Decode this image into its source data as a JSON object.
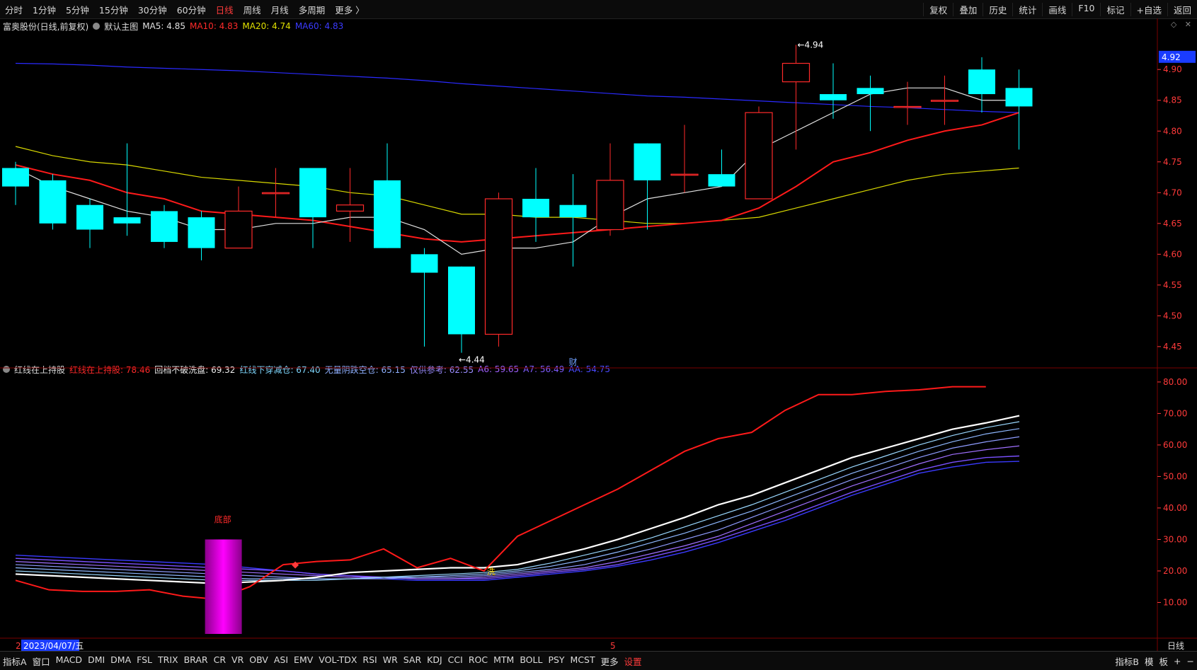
{
  "toolbar": {
    "periods": [
      "分时",
      "1分钟",
      "5分钟",
      "15分钟",
      "30分钟",
      "60分钟",
      "日线",
      "周线",
      "月线",
      "多周期",
      "更多 〉"
    ],
    "active_period": "日线",
    "right_items": [
      "复权",
      "叠加",
      "历史",
      "统计",
      "画线",
      "F10",
      "标记",
      "+自选",
      "返回"
    ]
  },
  "main_legend": {
    "stock": "富奥股份(日线,前复权)",
    "template": "默认主图",
    "ma5_label": "MA5: 4.85",
    "ma10_label": "MA10: 4.83",
    "ma20_label": "MA20: 4.74",
    "ma60_label": "MA60: 4.83"
  },
  "indicator_legend": {
    "name": "红线在上持股",
    "l1": "红线在上持股: 78.46",
    "l2": "回档不破洗盘: 69.32",
    "l3": "红线下穿减仓: 67.40",
    "l4": "无量阴跌空仓: 65.15",
    "l5": "仅供参考: 62.55",
    "l6": "A6: 59.65",
    "l7": "A7: 56.49",
    "l8": "AA: 54.75"
  },
  "bottom": {
    "tabs": [
      "指标A",
      "窗口",
      "MACD",
      "DMI",
      "DMA",
      "FSL",
      "TRIX",
      "BRAR",
      "CR",
      "VR",
      "OBV",
      "ASI",
      "EMV",
      "VOL-TDX",
      "RSI",
      "WR",
      "SAR",
      "KDJ",
      "CCI",
      "ROC",
      "MTM",
      "BOLL",
      "PSY",
      "MCST",
      "更多",
      "设置"
    ],
    "active_tab": "设置",
    "right": [
      "指标B",
      "模",
      "板",
      "+",
      "−"
    ]
  },
  "colors": {
    "up": "#ff2a2a",
    "down": "#00ffff",
    "ma5": "#e0e0e0",
    "ma10": "#ff1a1a",
    "ma20": "#d8d800",
    "ma60": "#2a2aff",
    "grid": "#7a0000",
    "axis": "#ff3a3a"
  },
  "chart_data": [
    {
      "type": "candlestick",
      "ylim": [
        4.42,
        4.96
      ],
      "yticks": [
        4.45,
        4.5,
        4.55,
        4.6,
        4.65,
        4.7,
        4.75,
        4.8,
        4.85,
        4.9
      ],
      "last_price_label": "4.92",
      "high_label": "4.94",
      "low_label": "4.44",
      "event_label": "财",
      "candles": [
        {
          "o": 4.74,
          "h": 4.75,
          "l": 4.68,
          "c": 4.71
        },
        {
          "o": 4.72,
          "h": 4.73,
          "l": 4.64,
          "c": 4.65
        },
        {
          "o": 4.68,
          "h": 4.69,
          "l": 4.61,
          "c": 4.64
        },
        {
          "o": 4.66,
          "h": 4.78,
          "l": 4.63,
          "c": 4.65
        },
        {
          "o": 4.67,
          "h": 4.68,
          "l": 4.61,
          "c": 4.62
        },
        {
          "o": 4.66,
          "h": 4.67,
          "l": 4.59,
          "c": 4.61
        },
        {
          "o": 4.61,
          "h": 4.71,
          "l": 4.61,
          "c": 4.67
        },
        {
          "o": 4.7,
          "h": 4.74,
          "l": 4.66,
          "c": 4.7
        },
        {
          "o": 4.74,
          "h": 4.74,
          "l": 4.61,
          "c": 4.66
        },
        {
          "o": 4.67,
          "h": 4.74,
          "l": 4.62,
          "c": 4.68
        },
        {
          "o": 4.72,
          "h": 4.78,
          "l": 4.61,
          "c": 4.61
        },
        {
          "o": 4.6,
          "h": 4.61,
          "l": 4.45,
          "c": 4.57
        },
        {
          "o": 4.58,
          "h": 4.58,
          "l": 4.44,
          "c": 4.47
        },
        {
          "o": 4.47,
          "h": 4.7,
          "l": 4.45,
          "c": 4.69
        },
        {
          "o": 4.69,
          "h": 4.74,
          "l": 4.62,
          "c": 4.66
        },
        {
          "o": 4.68,
          "h": 4.73,
          "l": 4.58,
          "c": 4.66
        },
        {
          "o": 4.64,
          "h": 4.78,
          "l": 4.63,
          "c": 4.72
        },
        {
          "o": 4.78,
          "h": 4.78,
          "l": 4.64,
          "c": 4.72
        },
        {
          "o": 4.73,
          "h": 4.81,
          "l": 4.7,
          "c": 4.73
        },
        {
          "o": 4.73,
          "h": 4.77,
          "l": 4.71,
          "c": 4.71
        },
        {
          "o": 4.69,
          "h": 4.84,
          "l": 4.69,
          "c": 4.83
        },
        {
          "o": 4.88,
          "h": 4.94,
          "l": 4.77,
          "c": 4.91
        },
        {
          "o": 4.86,
          "h": 4.91,
          "l": 4.82,
          "c": 4.85
        },
        {
          "o": 4.87,
          "h": 4.89,
          "l": 4.8,
          "c": 4.86
        },
        {
          "o": 4.84,
          "h": 4.88,
          "l": 4.81,
          "c": 4.84
        },
        {
          "o": 4.85,
          "h": 4.89,
          "l": 4.81,
          "c": 4.85
        },
        {
          "o": 4.9,
          "h": 4.92,
          "l": 4.83,
          "c": 4.86
        },
        {
          "o": 4.87,
          "h": 4.9,
          "l": 4.77,
          "c": 4.84
        }
      ],
      "ma5": [
        4.74,
        4.71,
        4.69,
        4.67,
        4.66,
        4.64,
        4.64,
        4.65,
        4.65,
        4.66,
        4.66,
        4.64,
        4.6,
        4.61,
        4.61,
        4.62,
        4.66,
        4.69,
        4.7,
        4.71,
        4.77,
        4.8,
        4.83,
        4.86,
        4.87,
        4.87,
        4.85,
        4.85
      ],
      "ma10": [
        4.745,
        4.73,
        4.72,
        4.7,
        4.69,
        4.67,
        4.665,
        4.66,
        4.655,
        4.645,
        4.635,
        4.625,
        4.62,
        4.625,
        4.63,
        4.635,
        4.64,
        4.645,
        4.65,
        4.655,
        4.675,
        4.71,
        4.75,
        4.765,
        4.785,
        4.8,
        4.81,
        4.83
      ],
      "ma20": [
        4.775,
        4.76,
        4.75,
        4.745,
        4.735,
        4.725,
        4.72,
        4.715,
        4.71,
        4.7,
        4.695,
        4.68,
        4.665,
        4.665,
        4.66,
        4.66,
        4.655,
        4.65,
        4.65,
        4.655,
        4.66,
        4.675,
        4.69,
        4.705,
        4.72,
        4.73,
        4.735,
        4.74
      ],
      "ma60": [
        4.91,
        4.909,
        4.907,
        4.904,
        4.902,
        4.9,
        4.898,
        4.895,
        4.892,
        4.889,
        4.886,
        4.882,
        4.877,
        4.873,
        4.869,
        4.865,
        4.861,
        4.857,
        4.855,
        4.852,
        4.849,
        4.846,
        4.843,
        4.84,
        4.838,
        4.835,
        4.832,
        4.83
      ]
    },
    {
      "type": "line",
      "ylim": [
        0,
        82
      ],
      "yticks": [
        10,
        20,
        30,
        40,
        50,
        60,
        70,
        80
      ],
      "series": [
        {
          "name": "红线在上持股",
          "values": [
            17,
            14,
            13.5,
            13.5,
            14,
            12,
            11,
            15,
            22,
            23,
            23.5,
            27,
            21,
            24,
            20,
            31,
            36,
            41,
            46,
            52,
            58,
            62,
            64,
            71,
            76,
            76,
            77,
            77.5,
            78.5,
            78.5
          ]
        },
        {
          "name": "回档不破洗盘",
          "values": [
            19,
            18.5,
            18,
            17.5,
            17,
            16.5,
            16,
            16.5,
            17,
            18,
            19.5,
            20,
            20.5,
            21,
            21,
            22,
            24.5,
            27,
            30,
            33.5,
            37,
            41,
            44,
            48,
            52,
            56,
            59,
            62,
            65,
            67,
            69.3
          ]
        },
        {
          "name": "红线下穿减仓",
          "values": [
            20,
            19.5,
            19,
            18.5,
            18,
            17.5,
            17,
            17,
            17,
            17,
            17.5,
            18,
            18.5,
            19,
            19.5,
            20.5,
            22.5,
            25,
            27.5,
            30.5,
            34,
            37.5,
            41,
            45,
            49,
            53,
            56.5,
            60,
            63,
            65.5,
            67.4
          ]
        },
        {
          "name": "无量阴跌空仓",
          "values": [
            21,
            20.5,
            20,
            19.5,
            19,
            18.5,
            18,
            17.5,
            17.5,
            17.5,
            17.5,
            18,
            18,
            18.5,
            19,
            20,
            21.5,
            23.5,
            26,
            29,
            32,
            35.5,
            39,
            43,
            47,
            51,
            54.5,
            58,
            61,
            63.5,
            65.2
          ]
        },
        {
          "name": "仅供参考",
          "values": [
            22,
            21.5,
            21,
            20.5,
            20,
            19.5,
            19,
            18.5,
            18,
            17.5,
            17.5,
            17.5,
            18,
            18,
            18.5,
            19.5,
            20.5,
            22,
            24.5,
            27,
            30,
            33,
            37,
            41,
            45,
            49,
            52.5,
            56,
            59,
            61,
            62.6
          ]
        },
        {
          "name": "A6",
          "values": [
            23,
            22.5,
            22,
            21.5,
            21,
            20.5,
            20,
            19.5,
            19,
            18.5,
            18,
            18,
            17.5,
            17.5,
            18,
            19,
            20,
            21,
            23,
            25.5,
            28,
            31,
            35,
            39,
            43,
            47,
            50.5,
            54,
            57,
            58.5,
            59.7
          ]
        },
        {
          "name": "A7",
          "values": [
            24,
            23.5,
            23,
            22.5,
            22,
            21.5,
            21,
            20.5,
            20,
            19,
            18.5,
            18,
            17.5,
            17.5,
            17.5,
            18.5,
            19.5,
            20.5,
            22,
            24.5,
            27,
            30,
            33.5,
            37,
            41,
            45,
            48.5,
            52,
            54.5,
            56,
            56.5
          ]
        },
        {
          "name": "AA",
          "values": [
            25,
            24.5,
            24,
            23.5,
            23,
            22.5,
            22,
            21,
            20,
            19,
            18.5,
            17.5,
            17,
            17,
            17,
            18,
            19,
            20,
            21.5,
            23.5,
            26,
            29,
            32.5,
            36,
            40,
            44,
            47.5,
            51,
            53,
            54.5,
            54.8
          ]
        }
      ],
      "bar": {
        "label": "底部",
        "x_index": 6,
        "top": 30,
        "bottom": 0
      },
      "marker_label": "洗",
      "date_label": "2023/04/07/五",
      "axis_markers": [
        "2",
        "5"
      ],
      "axis_right_label": "日线"
    }
  ]
}
